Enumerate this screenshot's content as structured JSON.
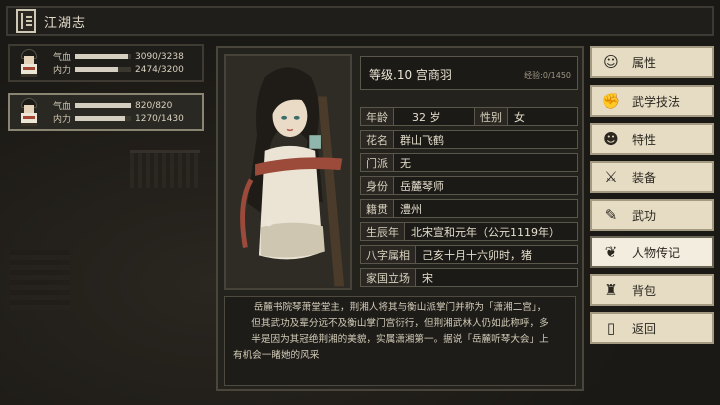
{
  "header": {
    "title": "江湖志"
  },
  "party": [
    {
      "hp_label": "气血",
      "hp_value": "3090/3238",
      "hp_fraction": 0.954,
      "mp_label": "内力",
      "mp_value": "2474/3200",
      "mp_fraction": 0.773
    },
    {
      "hp_label": "气血",
      "hp_value": "820/820",
      "hp_fraction": 1.0,
      "mp_label": "内力",
      "mp_value": "1270/1430",
      "mp_fraction": 0.888
    }
  ],
  "character": {
    "rank_title": "等级.10 宫商羽",
    "exp": "经验:0/1450",
    "age_label": "年龄",
    "age_value": "32 岁",
    "gender_label": "性别",
    "gender_value": "女",
    "alias_label": "花名",
    "alias_value": "群山飞鹤",
    "sect_label": "门派",
    "sect_value": "无",
    "identity_label": "身份",
    "identity_value": "岳麓琴师",
    "origin_label": "籍贯",
    "origin_value": "澧州",
    "birth_label": "生辰年",
    "birth_value": "北宋宣和元年（公元1119年）",
    "bazi_label": "八字属相",
    "bazi_value": "己亥十月十六卯时，猪",
    "nation_label": "家国立场",
    "nation_value": "宋",
    "bio_lines": [
      "岳麓书院琴萧堂堂主，荆湘人将其与衡山派掌门并称为「潇湘二宫」，",
      "但其武功及辈分远不及衡山掌门宫衍行，但荆湘武林人仍如此称呼，多",
      "半是因为其冠绝荆湘的美貌，实属潇湘第一。据说「岳麓听琴大会」上",
      "有机会一睹她的风采"
    ]
  },
  "menu": [
    {
      "label": "属性",
      "icon": "person-icon"
    },
    {
      "label": "武学技法",
      "icon": "fist-icon"
    },
    {
      "label": "特性",
      "icon": "figure-icon"
    },
    {
      "label": "装备",
      "icon": "sword-icon"
    },
    {
      "label": "武功",
      "icon": "scroll-icon"
    },
    {
      "label": "人物传记",
      "icon": "biography-icon"
    },
    {
      "label": "背包",
      "icon": "bag-icon"
    },
    {
      "label": "返回",
      "icon": "door-icon"
    }
  ]
}
